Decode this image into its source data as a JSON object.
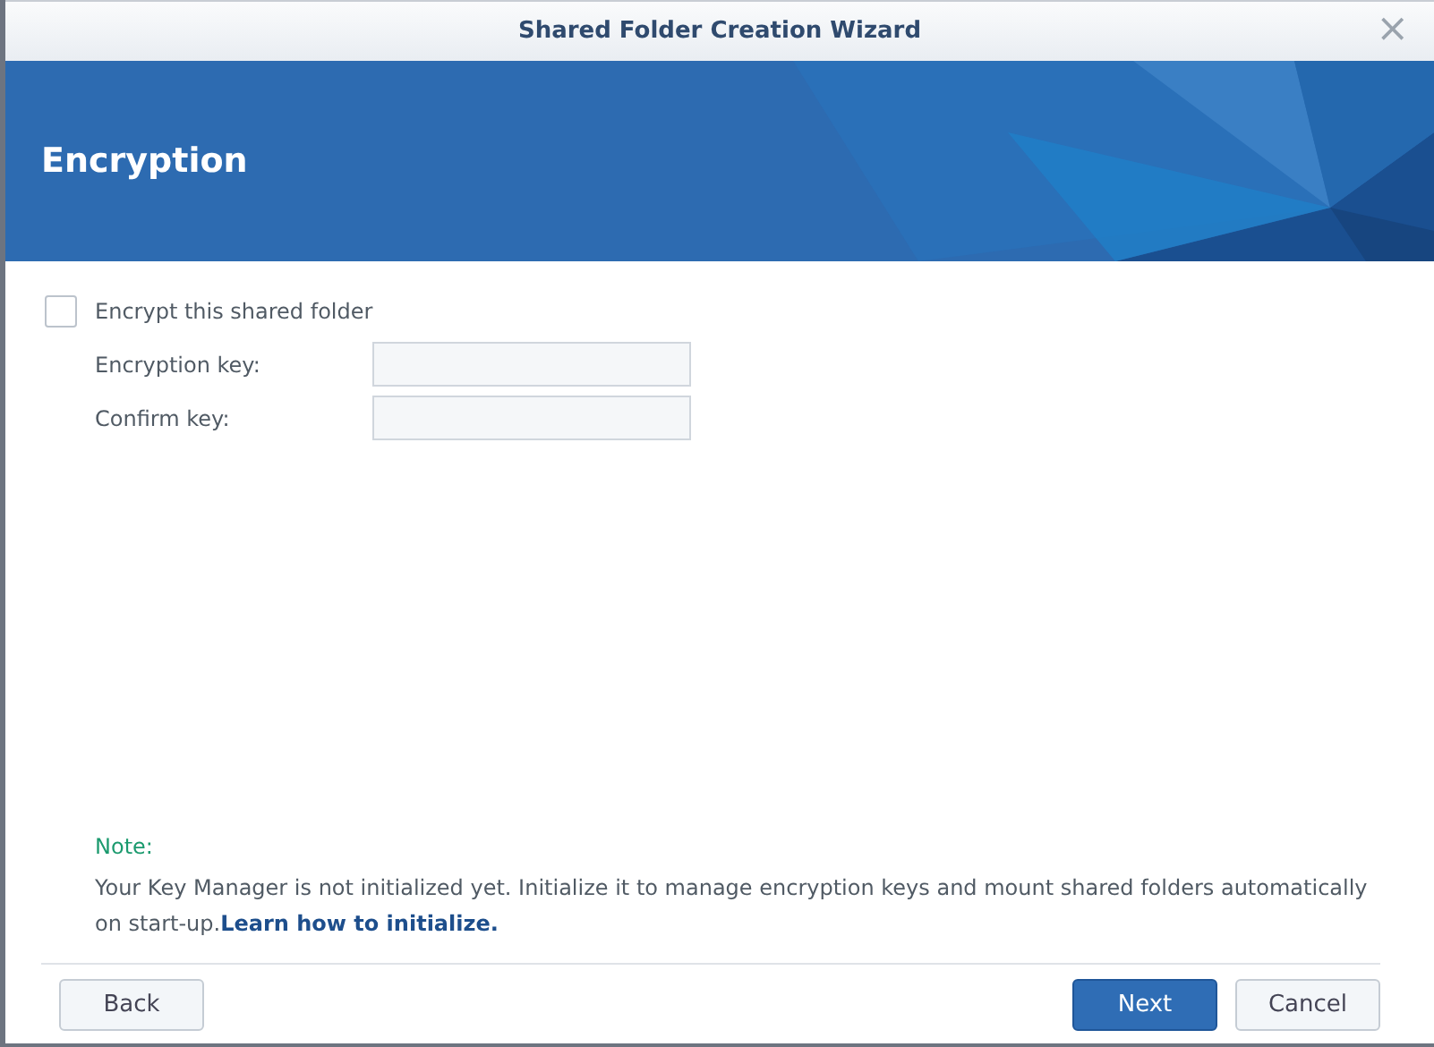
{
  "window": {
    "title": "Shared Folder Creation Wizard",
    "close": "×"
  },
  "header": {
    "title": "Encryption"
  },
  "encrypt": {
    "label": "Encrypt this shared folder",
    "checked": false
  },
  "fields": [
    {
      "label": "Encryption key:"
    },
    {
      "label": "Confirm key:"
    }
  ],
  "note": {
    "title": "Note:",
    "text": "Your Key Manager is not initialized yet. Initialize it to manage encryption keys and mount shared folders automatically on start-up.",
    "link": "Learn how to initialize."
  },
  "buttons": [
    {
      "label": "Back",
      "kind": "plain"
    },
    {
      "label": "Next",
      "kind": "primary"
    },
    {
      "label": "Cancel",
      "kind": "plain"
    }
  ]
}
